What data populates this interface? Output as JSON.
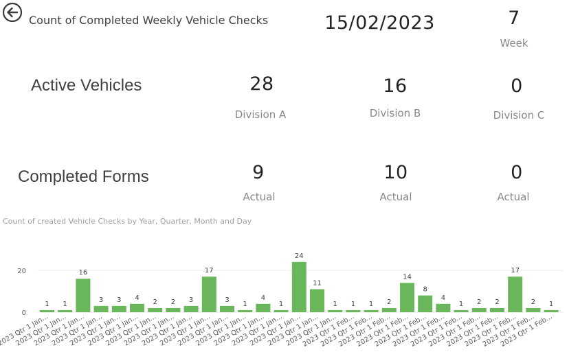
{
  "header": {
    "title": "Count of Completed Weekly Vehicle Checks",
    "date": "15/02/2023",
    "week_value": "7",
    "week_label": "Week"
  },
  "active_vehicles": {
    "title": "Active Vehicles",
    "divisions": [
      {
        "value": "28",
        "label": "Division A"
      },
      {
        "value": "16",
        "label": "Division B"
      },
      {
        "value": "0",
        "label": "Division C"
      }
    ]
  },
  "completed_forms": {
    "title": "Completed Forms",
    "items": [
      {
        "value": "9",
        "label": "Actual"
      },
      {
        "value": "10",
        "label": "Actual"
      },
      {
        "value": "0",
        "label": "Actual"
      }
    ]
  },
  "chart_data": {
    "type": "bar",
    "title": "Count of created Vehicle Checks by Year, Quarter, Month and Day",
    "categories": [
      "2023 Qtr 1 Jan...",
      "2023 Qtr 1 Jan...",
      "2023 Qtr 1 Jan...",
      "2023 Qtr 1 Jan...",
      "2023 Qtr 1 Jan...",
      "2023 Qtr 1 Jan...",
      "2023 Qtr 1 Jan...",
      "2023 Qtr 1 Jan...",
      "2023 Qtr 1 Jan...",
      "2023 Qtr 1 Jan...",
      "2023 Qtr 1 Jan...",
      "2023 Qtr 1 Jan...",
      "2023 Qtr 1 Jan...",
      "2023 Qtr 1 Jan...",
      "2023 Qtr 1 Jan...",
      "2023 Qtr 1 Jan...",
      "2023 Qtr 1 Jan...",
      "2023 Qtr 1 Feb...",
      "2023 Qtr 1 Feb...",
      "2023 Qtr 1 Feb...",
      "2023 Qtr 1 Feb...",
      "2023 Qtr 1 Feb...",
      "2023 Qtr 1 Feb...",
      "2023 Qtr 1 Feb...",
      "2023 Qtr 1 Feb...",
      "2023 Qtr 1 Feb...",
      "2023 Qtr 1 Feb...",
      "2023 Qtr 1 Feb...",
      "2023 Qtr 1 Feb...",
      "2023 Qtr 1 Feb..."
    ],
    "values": [
      1,
      1,
      16,
      3,
      3,
      4,
      2,
      2,
      3,
      17,
      3,
      1,
      4,
      1,
      24,
      11,
      1,
      1,
      1,
      2,
      14,
      8,
      4,
      1,
      2,
      2,
      17,
      2,
      1
    ],
    "yticks": [
      0,
      20
    ],
    "ylim": [
      0,
      26
    ],
    "grid": true,
    "bar_color": "#6ab75b"
  }
}
